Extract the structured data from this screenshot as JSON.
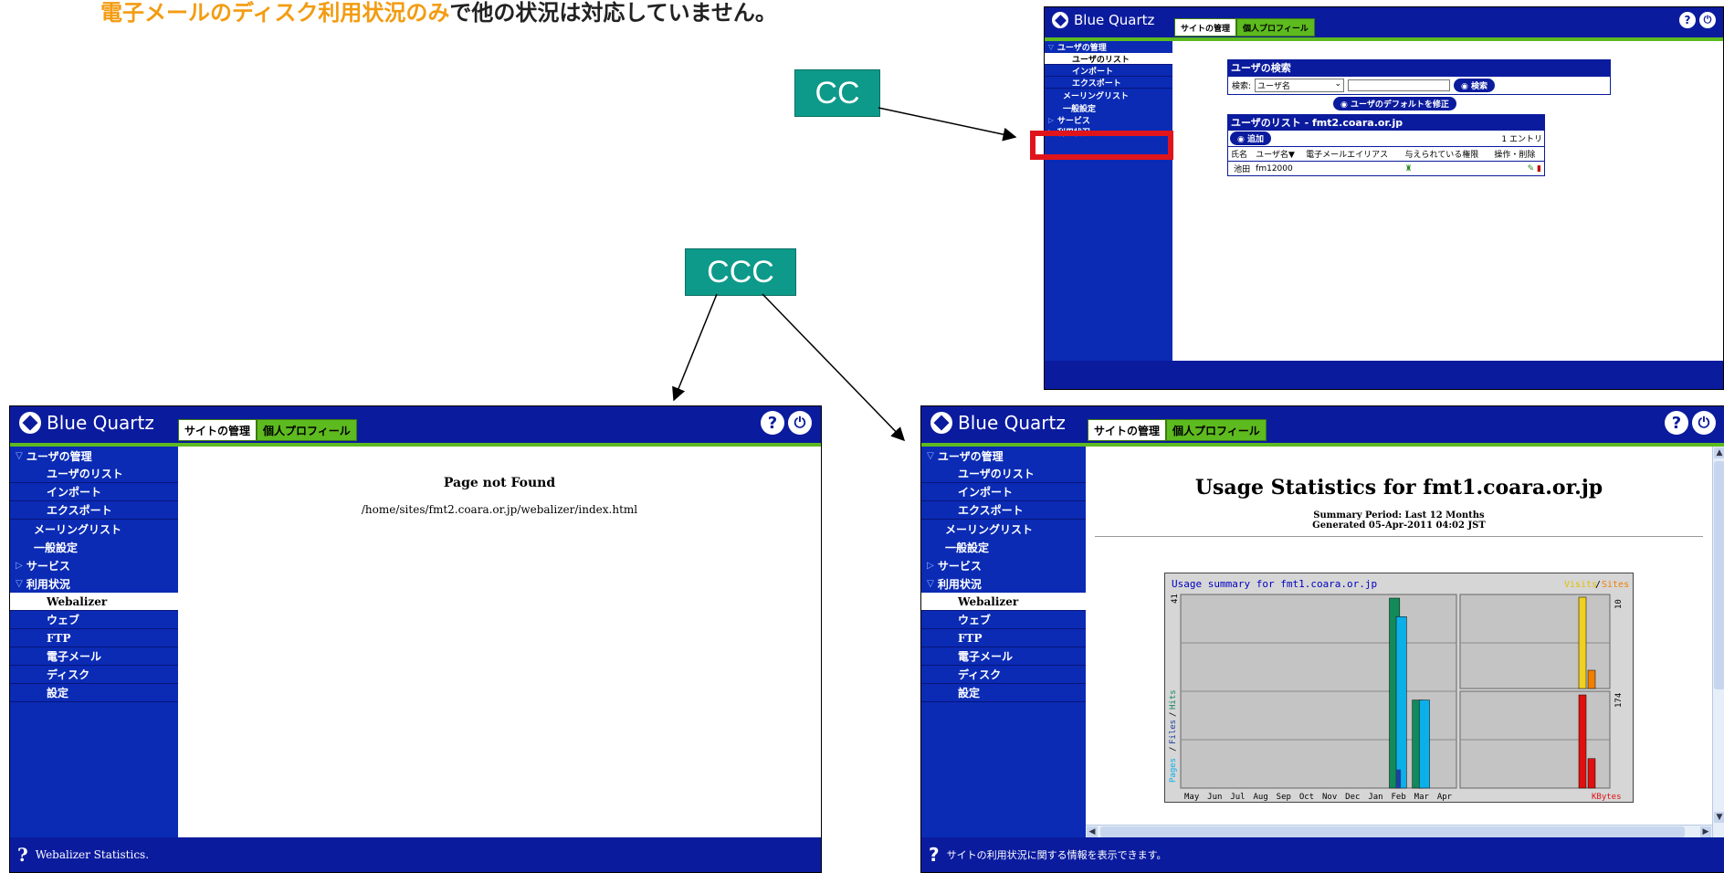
{
  "caption": {
    "highlight": "電子メールのディスク利用状況のみ",
    "rest": "で他の状況は対応していません。"
  },
  "callouts": {
    "cc": "CC",
    "ccc": "CCC"
  },
  "colors": {
    "window_bg": "#0b1b9e",
    "accent_green": "#5dba1f",
    "highlight_red": "#e0151b",
    "callout": "#0d9a8a",
    "caption_orange": "#f39c12"
  },
  "app": {
    "logo": "Blue Quartz",
    "tab_site": "サイトの管理",
    "tab_profile": "個人プロフィール",
    "help_icon": "?",
    "logout_icon": "⏻"
  },
  "sidebar": {
    "users_mgmt": "ユーザの管理",
    "user_list": "ユーザのリスト",
    "import": "インポート",
    "export": "エクスポート",
    "mailing_list": "メーリングリスト",
    "general": "一般設定",
    "service": "サービス",
    "usage": "利用状況",
    "webalizer": "Webalizer",
    "web": "ウェブ",
    "ftp": "FTP",
    "email": "電子メール",
    "disk": "ディスク",
    "settings": "設定"
  },
  "top_window": {
    "search_title": "ユーザの検索",
    "search_label": "検索:",
    "search_select": "ユーザ名",
    "search_button": "検索",
    "default_button": "ユーザのデフォルトを修正",
    "list_title": "ユーザのリスト - fmt2.coara.or.jp",
    "add_button": "追加",
    "entry_count": "1 エントリ",
    "columns": [
      "氏名",
      "ユーザ名▼",
      "電子メールエイリアス",
      "与えられている権限",
      "操作・削除"
    ],
    "rows": [
      {
        "name": "池田",
        "user": "fm12000",
        "alias": ""
      }
    ]
  },
  "left_window": {
    "title": "Page not Found",
    "path": "/home/sites/fmt2.coara.or.jp/webalizer/index.html",
    "footer": "Webalizer Statistics."
  },
  "right_window": {
    "title": "Usage Statistics for fmt1.coara.or.jp",
    "period": "Summary Period: Last 12 Months",
    "generated": "Generated 05-Apr-2011 04:02 JST",
    "footer": "サイトの利用状況に関する情報を表示できます。"
  },
  "chart_data": {
    "type": "bar",
    "title": "Usage summary for fmt1.coara.or.jp",
    "months": [
      "May",
      "Jun",
      "Jul",
      "Aug",
      "Sep",
      "Oct",
      "Nov",
      "Dec",
      "Jan",
      "Feb",
      "Mar",
      "Apr"
    ],
    "left_panel": {
      "ylabel_pages": "Pages",
      "ylabel_files": "Files",
      "ylabel_hits": "Hits",
      "ymax_label": "41",
      "ymax": 41,
      "series": [
        {
          "name": "Hits",
          "color": "#128a5a",
          "values": [
            0,
            0,
            0,
            0,
            0,
            0,
            0,
            0,
            0,
            41,
            19,
            0
          ]
        },
        {
          "name": "Files",
          "color": "#0bb0e8",
          "values": [
            0,
            0,
            0,
            0,
            0,
            0,
            0,
            0,
            0,
            37,
            19,
            0
          ]
        },
        {
          "name": "Pages",
          "color": "#1e40a0",
          "values": [
            0,
            0,
            0,
            0,
            0,
            0,
            0,
            0,
            0,
            4,
            0,
            0
          ]
        }
      ]
    },
    "right_top": {
      "legend_visits": "Visits",
      "legend_sites": "Sites",
      "ymax_label": "10",
      "ymax": 10,
      "series": [
        {
          "name": "Visits",
          "color": "#f0d020",
          "values": [
            10
          ]
        },
        {
          "name": "Sites",
          "color": "#f08000",
          "values": [
            2
          ]
        }
      ]
    },
    "right_bottom": {
      "legend_kbytes": "KBytes",
      "ymax_label": "174",
      "ymax": 174,
      "series": [
        {
          "name": "KBytes",
          "color": "#e01010",
          "values": [
            174,
            55
          ]
        }
      ]
    }
  }
}
